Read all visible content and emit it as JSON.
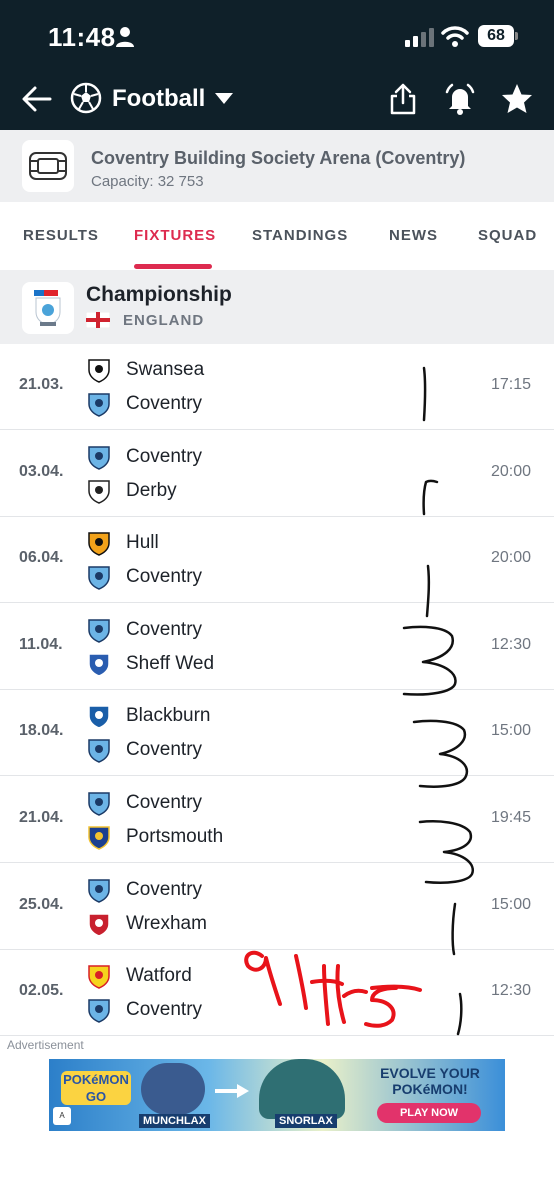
{
  "status_bar": {
    "time": "11:48",
    "battery": "68",
    "icons": [
      "person-icon",
      "signal-icon",
      "wifi-icon",
      "battery-icon"
    ]
  },
  "header": {
    "sport": "Football",
    "icons": [
      "back-arrow-icon",
      "football-icon",
      "caret-down-icon",
      "share-icon",
      "bell-icon",
      "star-icon"
    ],
    "background": "#0f2029"
  },
  "venue": {
    "name": "Coventry Building Society Arena (Coventry)",
    "capacity": "Capacity: 32 753"
  },
  "tabs": [
    {
      "label": "RESULTS",
      "active": false
    },
    {
      "label": "FIXTURES",
      "active": true
    },
    {
      "label": "STANDINGS",
      "active": false
    },
    {
      "label": "NEWS",
      "active": false
    },
    {
      "label": "SQUAD",
      "active": false
    }
  ],
  "accent": "#dd2b4f",
  "league": {
    "name": "Championship",
    "country": "ENGLAND"
  },
  "fixtures": [
    {
      "date": "21.03.",
      "home": "Swansea",
      "away": "Coventry",
      "time": "17:15"
    },
    {
      "date": "03.04.",
      "home": "Coventry",
      "away": "Derby",
      "time": "20:00"
    },
    {
      "date": "06.04.",
      "home": "Hull",
      "away": "Coventry",
      "time": "20:00"
    },
    {
      "date": "11.04.",
      "home": "Coventry",
      "away": "Sheff Wed",
      "time": "12:30"
    },
    {
      "date": "18.04.",
      "home": "Blackburn",
      "away": "Coventry",
      "time": "15:00"
    },
    {
      "date": "21.04.",
      "home": "Coventry",
      "away": "Portsmouth",
      "time": "19:45"
    },
    {
      "date": "25.04.",
      "home": "Coventry",
      "away": "Wrexham",
      "time": "15:00"
    },
    {
      "date": "02.05.",
      "home": "Watford",
      "away": "Coventry",
      "time": "12:30"
    }
  ],
  "ad": {
    "label": "Advertisement",
    "brand": "POKéMON GO",
    "from": "MUNCHLAX",
    "to": "SNORLAX",
    "headline": "EVOLVE YOUR POKéMON!",
    "cta": "PLAY NOW",
    "badge": "A"
  }
}
